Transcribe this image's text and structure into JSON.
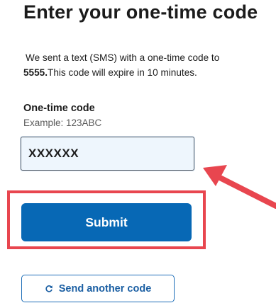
{
  "heading": "Enter your one-time code",
  "description": {
    "line1": "We sent a text (SMS) with a one-time code to",
    "phone_suffix": "5555.",
    "line2_rest": "This code will expire in 10 minutes."
  },
  "code_field": {
    "label": "One-time code",
    "hint": "Example: 123ABC",
    "value": "XXXXXX"
  },
  "submit_label": "Submit",
  "resend": {
    "icon": "refresh-icon",
    "label": "Send another code"
  },
  "colors": {
    "primary": "#0768b5",
    "highlight": "#e8464f",
    "input_bg": "#eef6fd"
  }
}
